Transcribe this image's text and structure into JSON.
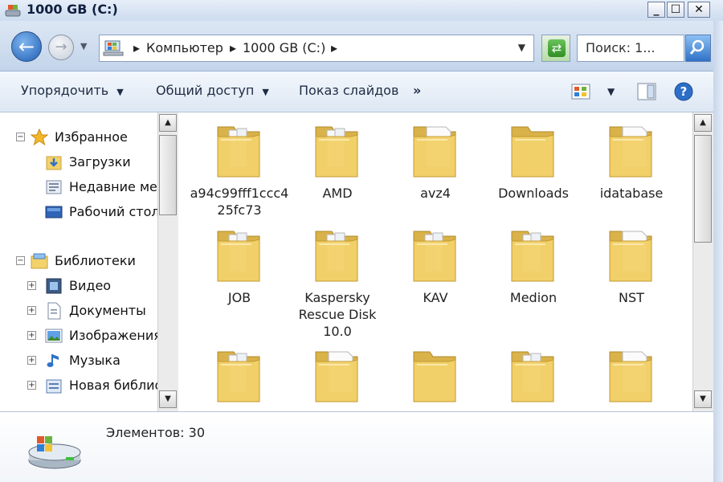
{
  "window": {
    "title": "1000 GB (C:)",
    "controls": {
      "minimize": "_",
      "maximize": "☐",
      "close": "✕"
    }
  },
  "address": {
    "crumbs": [
      "Компьютер",
      "1000 GB (C:)"
    ],
    "search_placeholder": "Поиск: 1..."
  },
  "toolbar": {
    "organize": "Упорядочить",
    "share": "Общий доступ",
    "slideshow": "Показ слайдов",
    "more": "»"
  },
  "nav": {
    "favorites": {
      "label": "Избранное",
      "items": [
        "Загрузки",
        "Недавние места",
        "Рабочий стол"
      ]
    },
    "libraries": {
      "label": "Библиотеки",
      "items": [
        "Видео",
        "Документы",
        "Изображения",
        "Музыка",
        "Новая библиотека"
      ]
    }
  },
  "files": [
    {
      "name": "a94c99fff1ccc425fc73",
      "variant": "docs"
    },
    {
      "name": "AMD",
      "variant": "docs"
    },
    {
      "name": "avz4",
      "variant": "paper"
    },
    {
      "name": "Downloads",
      "variant": "plain"
    },
    {
      "name": "idatabase",
      "variant": "paper"
    },
    {
      "name": "JOB",
      "variant": "docs"
    },
    {
      "name": "Kaspersky Rescue Disk 10.0",
      "variant": "docs"
    },
    {
      "name": "KAV",
      "variant": "docs"
    },
    {
      "name": "Medion",
      "variant": "docs"
    },
    {
      "name": "NST",
      "variant": "paper"
    },
    {
      "name": "",
      "variant": "docs"
    },
    {
      "name": "",
      "variant": "paper"
    },
    {
      "name": "",
      "variant": "plain"
    },
    {
      "name": "",
      "variant": "docs"
    },
    {
      "name": "",
      "variant": "paper"
    }
  ],
  "status": {
    "items_text": "Элементов: 30"
  },
  "colors": {
    "folder": "#f3d26b",
    "accent": "#1f5fb4"
  }
}
